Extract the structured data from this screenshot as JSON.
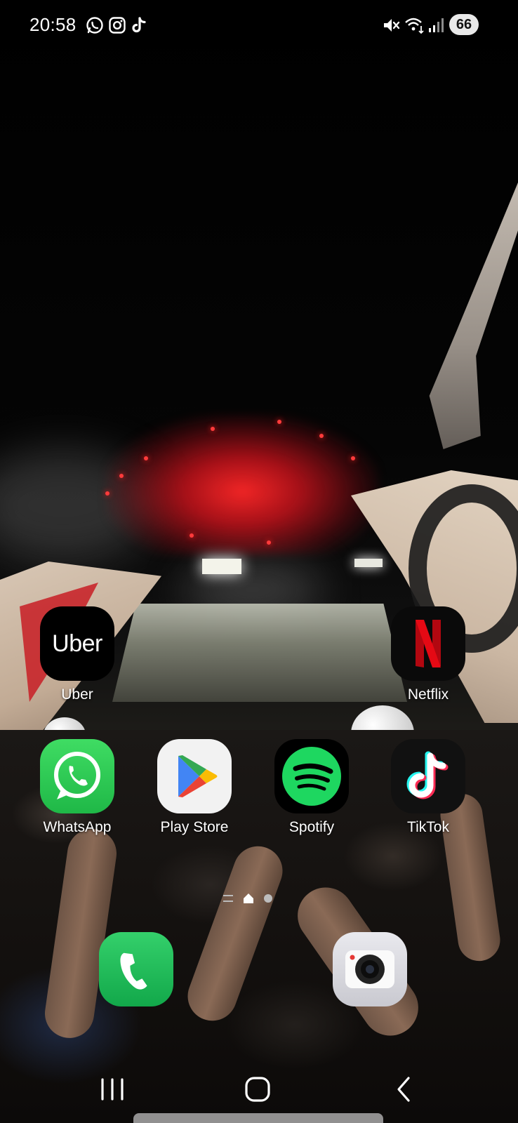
{
  "status_bar": {
    "time": "20:58",
    "notification_icons": [
      "whatsapp-icon",
      "instagram-icon",
      "tiktok-icon"
    ],
    "system_icons": [
      "mute-icon",
      "wifi-icon",
      "signal-icon"
    ],
    "battery": "66"
  },
  "home": {
    "row1": [
      {
        "label": "Uber",
        "icon": "uber-icon",
        "logo_text": "Uber"
      },
      {
        "label": "Netflix",
        "icon": "netflix-icon",
        "logo_text": "N"
      }
    ],
    "row2": [
      {
        "label": "WhatsApp",
        "icon": "whatsapp-icon"
      },
      {
        "label": "Play Store",
        "icon": "play-store-icon"
      },
      {
        "label": "Spotify",
        "icon": "spotify-icon"
      },
      {
        "label": "TikTok",
        "icon": "tiktok-icon"
      }
    ]
  },
  "page_indicator": {
    "pages": 2,
    "current": 1
  },
  "dock": [
    {
      "app": "phone",
      "icon": "phone-icon"
    },
    {
      "app": "camera",
      "icon": "camera-icon"
    }
  ],
  "navbar": {
    "buttons": [
      "recent-apps",
      "home",
      "back"
    ]
  },
  "colors": {
    "whatsapp": "#25D366",
    "spotify": "#1ED760",
    "netflix": "#E50914",
    "fireworks": "#FF2A2A"
  }
}
